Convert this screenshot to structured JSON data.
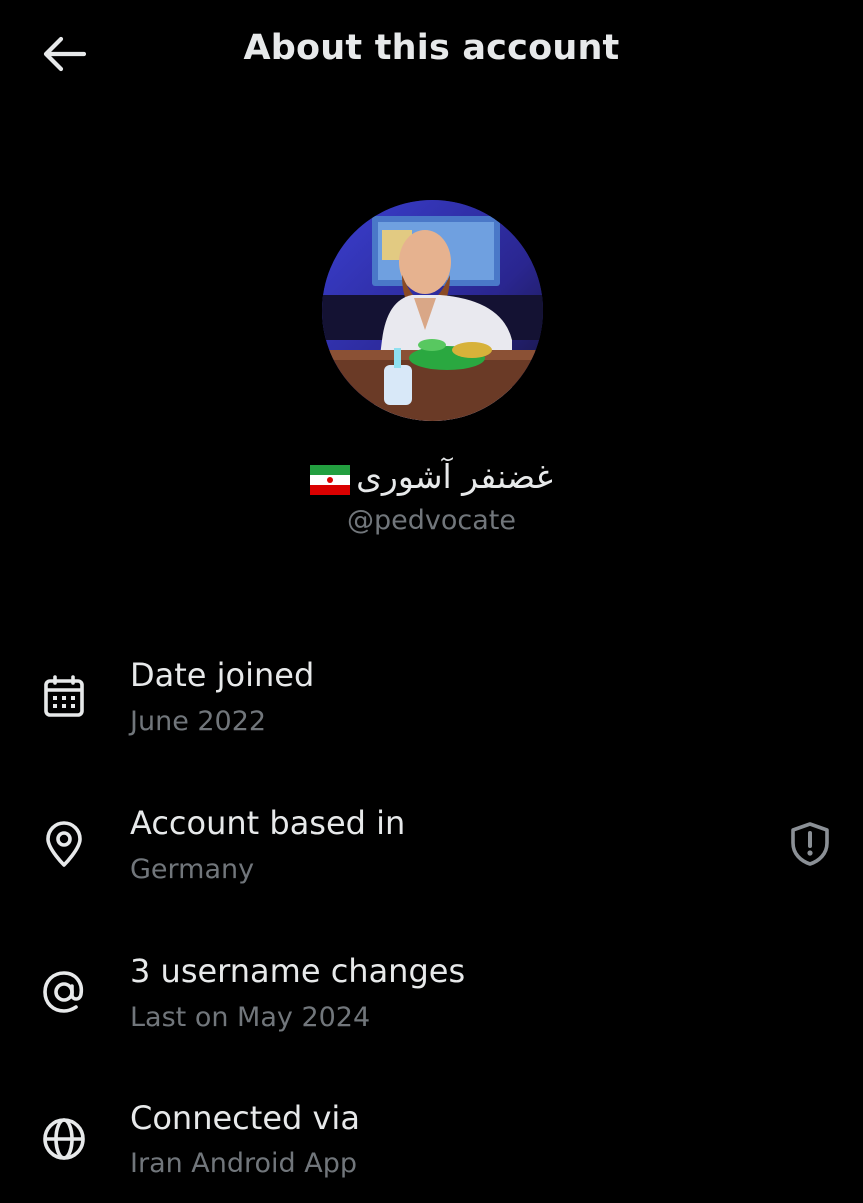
{
  "header": {
    "title": "About this account",
    "back_icon": "arrow-left-icon"
  },
  "profile": {
    "display_name": "غضنفر آشوری",
    "flag": "iran-flag",
    "handle": "@pedvocate"
  },
  "rows": [
    {
      "icon": "calendar-icon",
      "title": "Date joined",
      "subtitle": "June 2022"
    },
    {
      "icon": "location-pin-icon",
      "title": "Account based in",
      "subtitle": "Germany",
      "trailing_icon": "shield-alert-icon"
    },
    {
      "icon": "at-sign-icon",
      "title": "3 username changes",
      "subtitle": "Last on May 2024"
    },
    {
      "icon": "globe-icon",
      "title": "Connected via",
      "subtitle": "Iran Android App"
    }
  ],
  "colors": {
    "background": "#000000",
    "primary_text": "#e7e9ea",
    "secondary_text": "#71767b"
  }
}
